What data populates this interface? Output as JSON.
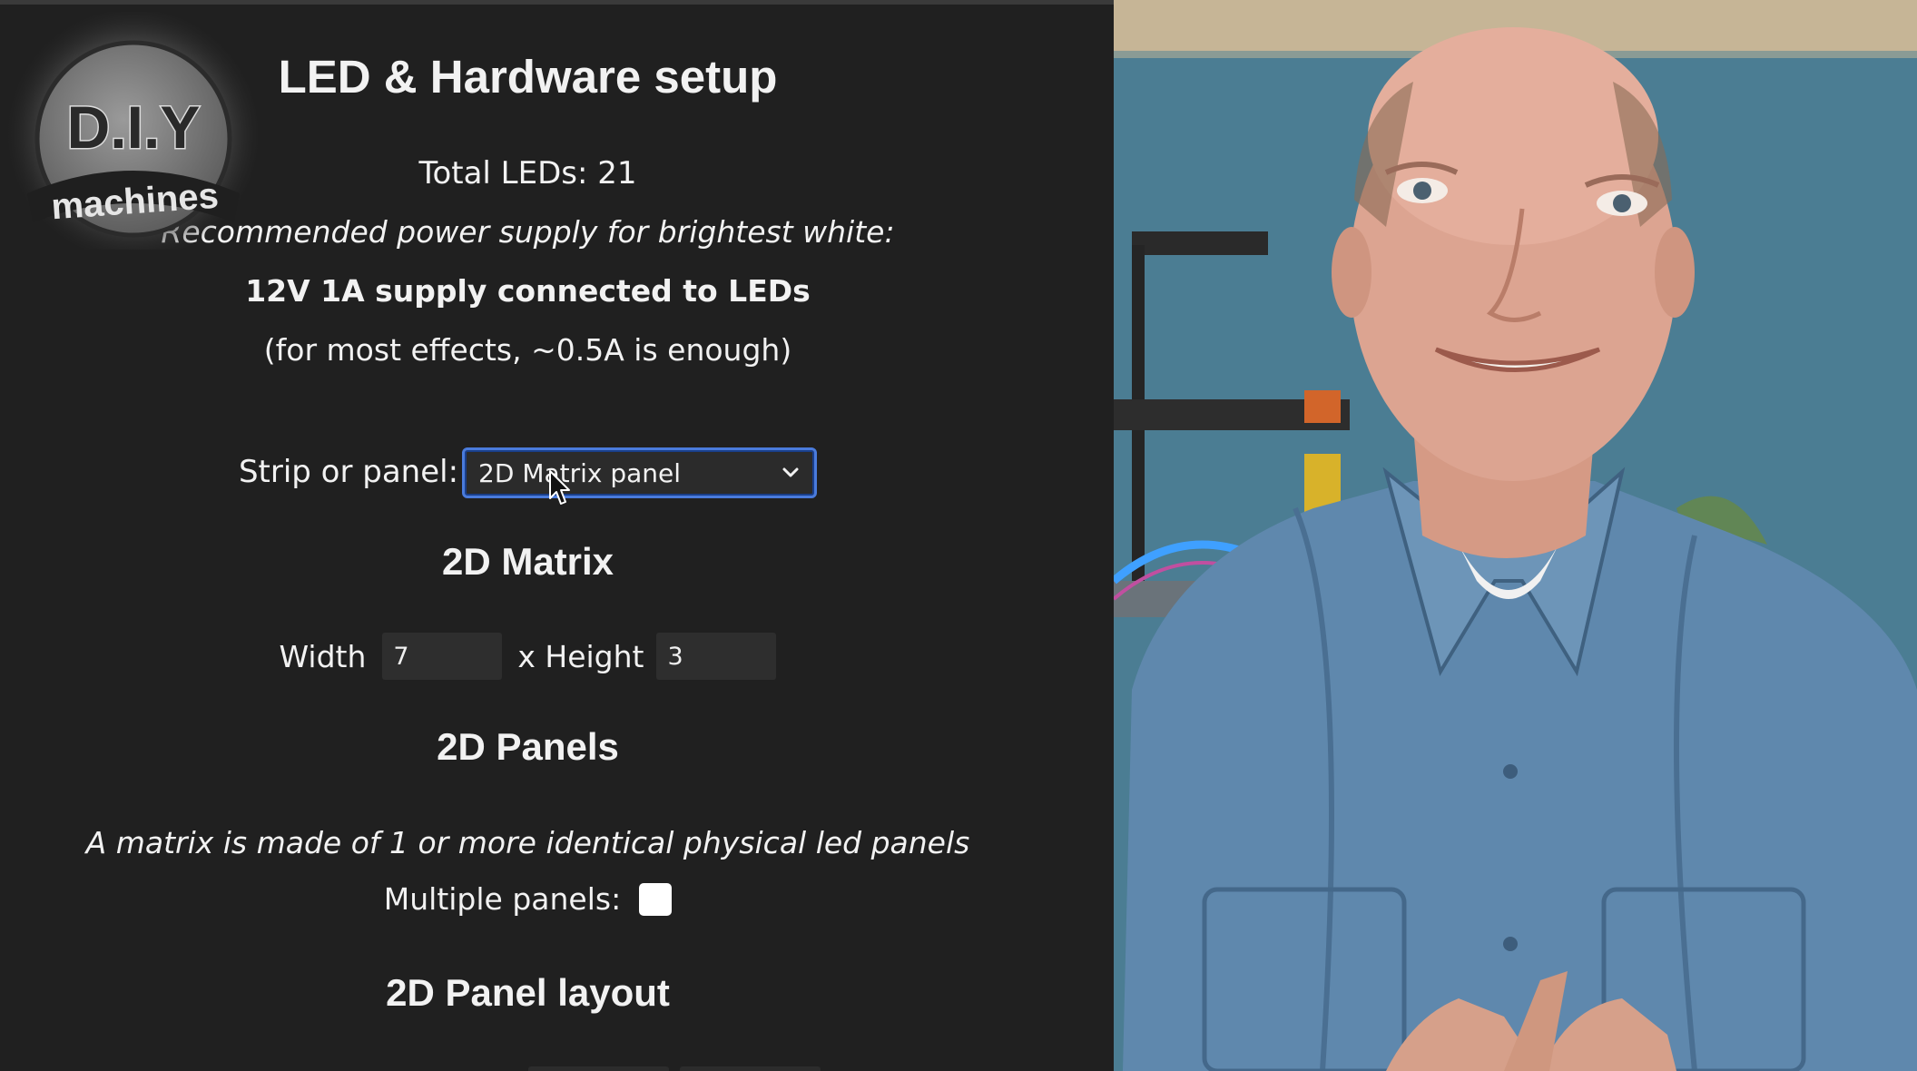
{
  "setup": {
    "title": "LED & Hardware setup",
    "total_leds": "Total LEDs: 21",
    "psu_recommend": "Recommended power supply for brightest white:",
    "psu_supply": "12V 1A supply connected to LEDs",
    "psu_note": "(for most effects, ~0.5A is enough)",
    "strip_label": "Strip or panel:",
    "strip_selected": "2D Matrix panel",
    "matrix_heading": "2D Matrix",
    "width_label": "Width",
    "width_value": "7",
    "height_label": "x Height",
    "height_value": "3",
    "panels_heading": "2D Panels",
    "panels_desc": "A matrix is made of 1 or more identical physical led panels",
    "multiple_label": "Multiple panels:",
    "multiple_checked": false,
    "layout_heading": "2D Panel layout"
  },
  "logo": {
    "top_text": "D.I.Y",
    "bottom_text": "machines"
  },
  "icons": {
    "dropdown": "chevron-down-icon",
    "cursor": "mouse-pointer-icon"
  },
  "colors": {
    "panel_bg": "#202020",
    "select_focus": "#4a7bdc",
    "text": "#f2f2f2"
  }
}
